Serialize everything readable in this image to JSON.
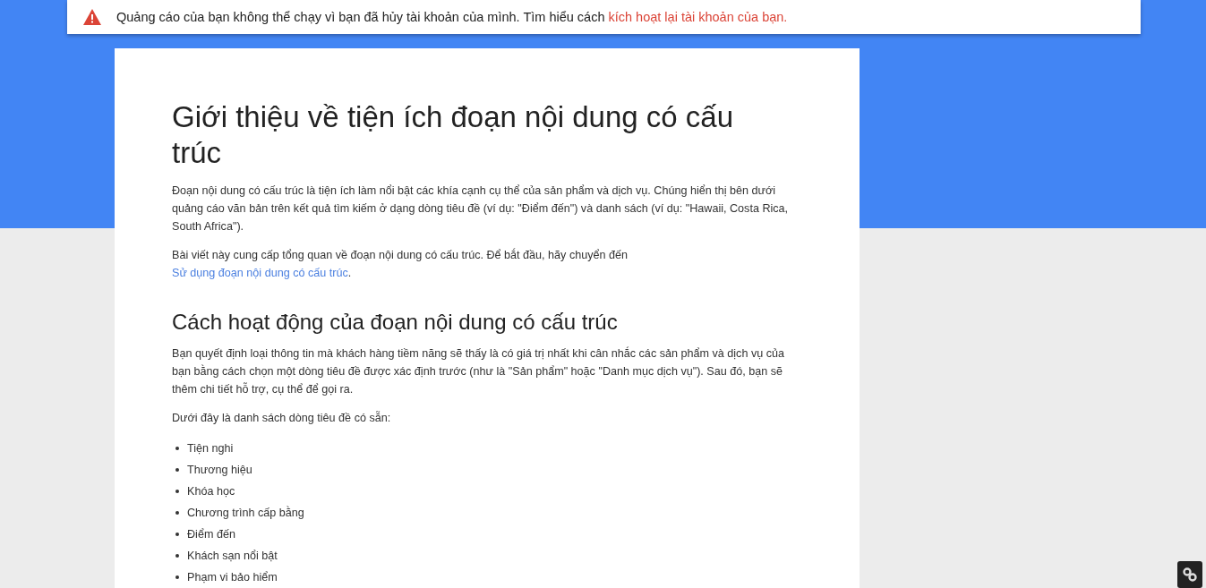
{
  "alert": {
    "text": "Quảng cáo của bạn không thể chạy vì bạn đã hủy tài khoản của mình. Tìm hiểu cách",
    "link": "kích hoạt lại tài khoản của bạn."
  },
  "article": {
    "title": "Giới thiệu về tiện ích đoạn nội dung có cấu trúc",
    "intro": [
      {
        "text": "Đoạn nội dung có cấu trúc là tiện ích làm nổi bật các khía cạnh cụ thể của sản phẩm và dịch vụ.  Chúng hiển thị bên dưới quảng cáo văn bản trên kết quả tìm kiếm ở dạng dòng tiêu đề (ví dụ: \"Điểm đến\") và danh sách (ví dụ: \"Hawaii, Costa Rica, South Africa\")."
      },
      {
        "text": "Bài viết này cung cấp tổng quan về đoạn nội dung có cấu trúc. Để bắt đầu, hãy chuyển đến",
        "link": "Sử dụng đoạn nội dung có cấu trúc",
        "after": "."
      }
    ],
    "section_heading": "Cách hoạt động của đoạn nội dung có cấu trúc",
    "section_paragraphs": [
      {
        "text": "Bạn quyết định loại thông tin mà khách hàng tiềm năng sẽ thấy là có giá trị nhất khi cân nhắc các sản phẩm và dịch vụ của bạn bằng cách chọn một dòng tiêu đề được xác định trước (như là \"Sản phẩm\" hoặc \"Danh mục dịch vụ\"). Sau đó, bạn sẽ thêm chi tiết hỗ trợ, cụ thể để gọi ra."
      },
      {
        "text": "Dưới đây là danh sách dòng tiêu đề có sẵn:"
      }
    ],
    "headers": [
      "Tiện nghi",
      "Thương hiệu",
      "Khóa học",
      "Chương trình cấp bằng",
      "Điểm đến",
      "Khách sạn nổi bật",
      "Phạm vi bảo hiểm"
    ]
  }
}
